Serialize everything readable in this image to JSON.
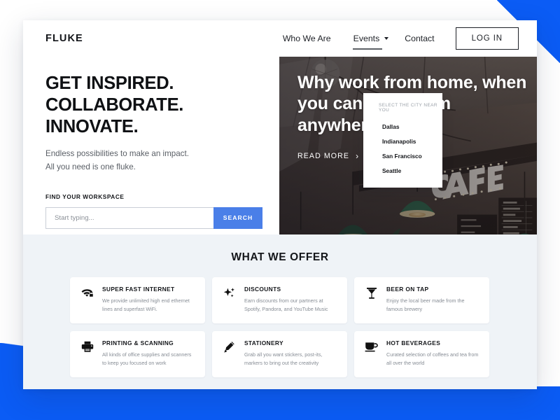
{
  "brand": {
    "logo": "FLUKE",
    "accent_blue": "#0b5cf5",
    "button_blue": "#4a7fe8"
  },
  "nav": {
    "links": [
      {
        "label": "Who We Are",
        "has_caret": false,
        "active": false
      },
      {
        "label": "Events",
        "has_caret": true,
        "active": true
      },
      {
        "label": "Contact",
        "has_caret": false,
        "active": false
      }
    ],
    "login_label": "LOG IN"
  },
  "dropdown": {
    "header": "SELECT THE CITY NEAR YOU",
    "items": [
      {
        "label": "Dallas"
      },
      {
        "label": "Indianapolis"
      },
      {
        "label": "San Francisco"
      },
      {
        "label": "Seattle"
      }
    ]
  },
  "hero": {
    "headline_line1": "GET INSPIRED.",
    "headline_line2": "COLLABORATE.",
    "headline_line3": "INNOVATE.",
    "sub_line1": "Endless possibilities to make an impact.",
    "sub_line2": "All you need is one fluke.",
    "find_label": "FIND YOUR WORKSPACE",
    "search_placeholder": "Start typing...",
    "search_value": "",
    "search_button": "SEARCH",
    "image_title": "Why work from home, when you can work from anywhere?",
    "read_more": "READ MORE",
    "read_more_chevron": "›",
    "image_alt": "cafe-interior-photo"
  },
  "offers": {
    "title": "WHAT WE OFFER",
    "cards": [
      {
        "icon": "secure-wifi-icon",
        "title": "SUPER FAST INTERNET",
        "desc": "We provide unlimited high end ethernet lines and superfast WiFi."
      },
      {
        "icon": "sparkle-icon",
        "title": "DISCOUNTS",
        "desc": "Earn discounts from our partners at Spotify, Pandora, and YouTube Music"
      },
      {
        "icon": "cocktail-glass-icon",
        "title": "BEER ON TAP",
        "desc": "Enjoy the local beer made from the famous brewery"
      },
      {
        "icon": "printer-icon",
        "title": "PRINTING & SCANNING",
        "desc": "All kinds of office supplies and scanners to keep you focused on work"
      },
      {
        "icon": "marker-pen-icon",
        "title": "STATIONERY",
        "desc": "Grab all you want stickers, post-its, markers to bring out the creativity"
      },
      {
        "icon": "coffee-cup-icon",
        "title": "HOT BEVERAGES",
        "desc": "Curated selection of coffees and tea from all over the world"
      }
    ]
  }
}
